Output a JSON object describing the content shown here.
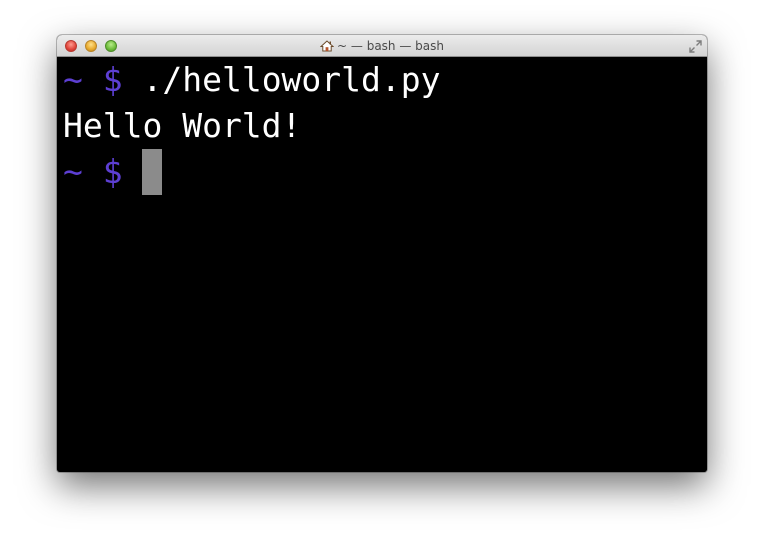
{
  "window": {
    "title": "~ — bash — bash",
    "home_icon": "home-icon",
    "fullscreen_icon": "fullscreen-icon"
  },
  "colors": {
    "prompt": "#5d3fd3",
    "text": "#ffffff",
    "background": "#000000",
    "cursor": "#8b8b8b"
  },
  "terminal": {
    "lines": [
      {
        "prompt": "~ $ ",
        "text": "./helloworld.py"
      },
      {
        "prompt": "",
        "text": "Hello World!"
      },
      {
        "prompt": "~ $ ",
        "text": ""
      }
    ]
  }
}
